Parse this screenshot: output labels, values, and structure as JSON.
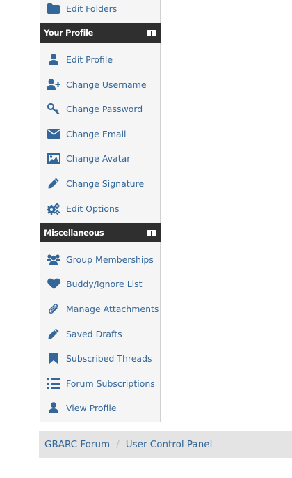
{
  "colors": {
    "link": "#336699",
    "section_header_bg": "#2f2f2f",
    "panel_bg": "#f5f5f5",
    "breadcrumb_bg": "#e4e4e4"
  },
  "folders": {
    "items": [
      {
        "label": "Edit Folders",
        "icon": "folder-icon"
      }
    ]
  },
  "profile": {
    "title": "Your Profile",
    "items": [
      {
        "label": "Edit Profile",
        "icon": "user-icon"
      },
      {
        "label": "Change Username",
        "icon": "user-plus-icon"
      },
      {
        "label": "Change Password",
        "icon": "key-icon"
      },
      {
        "label": "Change Email",
        "icon": "envelope-icon"
      },
      {
        "label": "Change Avatar",
        "icon": "image-icon"
      },
      {
        "label": "Change Signature",
        "icon": "pencil-icon"
      },
      {
        "label": "Edit Options",
        "icon": "cogs-icon"
      }
    ]
  },
  "misc": {
    "title": "Miscellaneous",
    "items": [
      {
        "label": "Group Memberships",
        "icon": "users-icon"
      },
      {
        "label": "Buddy/Ignore List",
        "icon": "heart-icon"
      },
      {
        "label": "Manage Attachments",
        "icon": "paperclip-icon"
      },
      {
        "label": "Saved Drafts",
        "icon": "pencil-icon"
      },
      {
        "label": "Subscribed Threads",
        "icon": "bookmark-icon"
      },
      {
        "label": "Forum Subscriptions",
        "icon": "list-icon"
      },
      {
        "label": "View Profile",
        "icon": "user-icon"
      }
    ]
  },
  "breadcrumb": {
    "items": [
      {
        "label": "GBARC Forum"
      },
      {
        "label": "User Control Panel"
      }
    ],
    "separator": "/"
  }
}
